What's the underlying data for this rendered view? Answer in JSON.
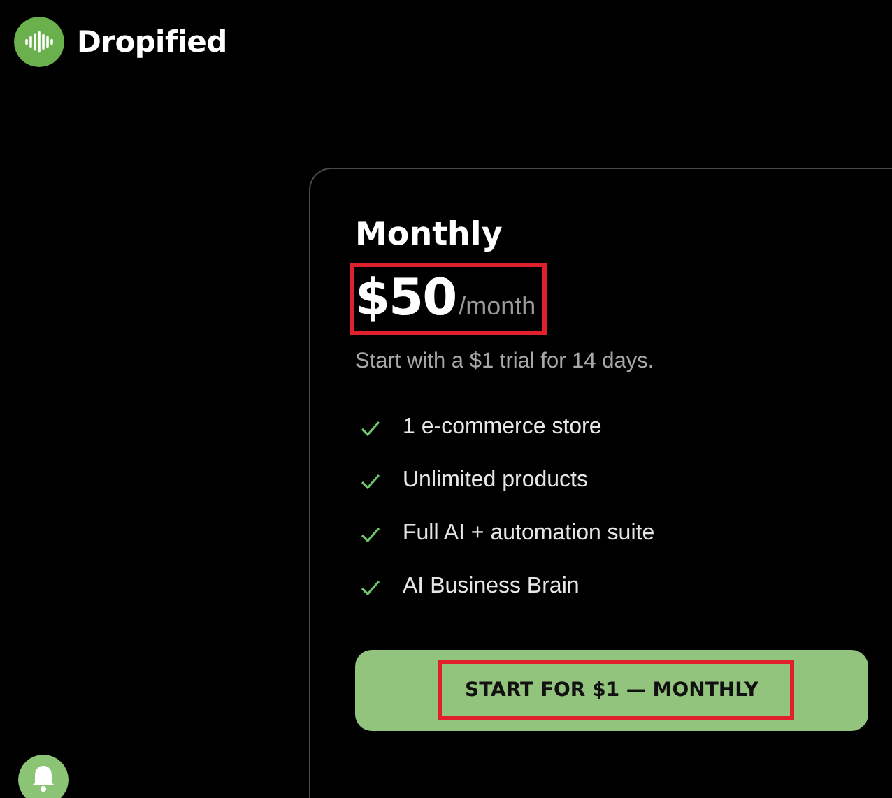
{
  "brand": {
    "name": "Dropified"
  },
  "plan": {
    "title": "Monthly",
    "price": "$50",
    "period": "/month",
    "price_highlighted": true,
    "subtitle": "Start with a $1 trial for 14 days.",
    "features": [
      {
        "label": "1 e-commerce store"
      },
      {
        "label": "Unlimited products"
      },
      {
        "label": "Full AI + automation suite"
      },
      {
        "label": "AI Business Brain"
      }
    ],
    "button": {
      "label": "START FOR $1 — MONTHLY",
      "highlighted": true
    }
  }
}
